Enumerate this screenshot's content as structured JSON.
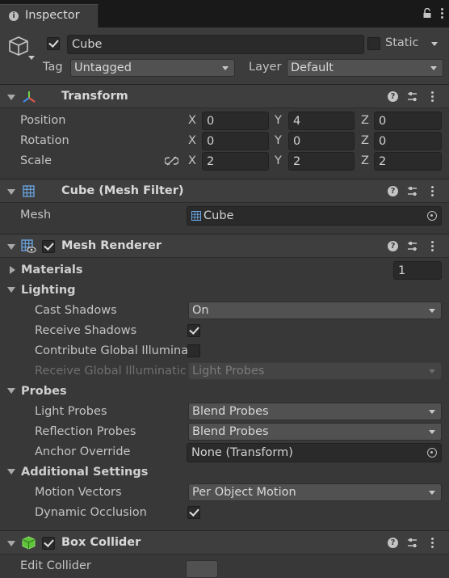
{
  "tab": {
    "title": "Inspector"
  },
  "header": {
    "object_name": "Cube",
    "active": true,
    "static_label": "Static",
    "static_checked": false,
    "tag_label": "Tag",
    "tag_value": "Untagged",
    "layer_label": "Layer",
    "layer_value": "Default"
  },
  "transform": {
    "title": "Transform",
    "rows": [
      {
        "label": "Position",
        "x": "0",
        "y": "4",
        "z": "0"
      },
      {
        "label": "Rotation",
        "x": "0",
        "y": "0",
        "z": "0"
      },
      {
        "label": "Scale",
        "x": "2",
        "y": "2",
        "z": "2"
      }
    ],
    "axes": [
      "X",
      "Y",
      "Z"
    ]
  },
  "mesh_filter": {
    "title": "Cube (Mesh Filter)",
    "mesh_label": "Mesh",
    "mesh_value": "Cube"
  },
  "mesh_renderer": {
    "title": "Mesh Renderer",
    "enabled": true,
    "materials_label": "Materials",
    "materials_count": "1",
    "lighting_label": "Lighting",
    "cast_shadows_label": "Cast Shadows",
    "cast_shadows_value": "On",
    "receive_shadows_label": "Receive Shadows",
    "receive_shadows": true,
    "contribute_gi_label": "Contribute Global Illumina",
    "contribute_gi": false,
    "receive_gi_label": "Receive Global Illuminatic",
    "receive_gi_value": "Light Probes",
    "probes_label": "Probes",
    "light_probes_label": "Light Probes",
    "light_probes_value": "Blend Probes",
    "reflection_probes_label": "Reflection Probes",
    "reflection_probes_value": "Blend Probes",
    "anchor_override_label": "Anchor Override",
    "anchor_override_value": "None (Transform)",
    "additional_label": "Additional Settings",
    "motion_vectors_label": "Motion Vectors",
    "motion_vectors_value": "Per Object Motion",
    "dynamic_occlusion_label": "Dynamic Occlusion",
    "dynamic_occlusion": true
  },
  "box_collider": {
    "title": "Box Collider",
    "enabled": true,
    "edit_collider_label": "Edit Collider"
  }
}
